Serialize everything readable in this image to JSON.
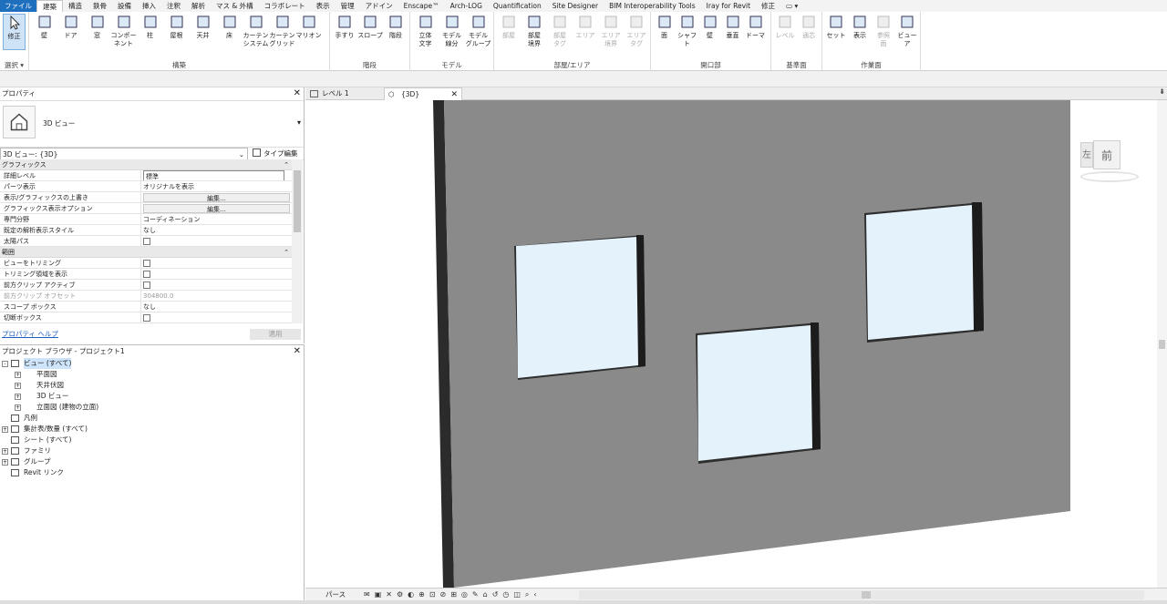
{
  "ribbon_tabs": [
    "ファイル",
    "建築",
    "構造",
    "鉄骨",
    "設備",
    "挿入",
    "注釈",
    "解析",
    "マス & 外構",
    "コラボレート",
    "表示",
    "管理",
    "アドイン",
    "Enscape™",
    "Arch-LOG",
    "Quantification",
    "Site Designer",
    "BIM Interoperability Tools",
    "Iray for Revit",
    "修正"
  ],
  "active_tab": "建築",
  "ribbon": {
    "select": {
      "modify": "修正",
      "label": "選択"
    },
    "build": {
      "items": [
        "壁",
        "ドア",
        "窓",
        "コンポーネント",
        "柱",
        "屋根",
        "天井",
        "床",
        "カーテン\nシステム",
        "カーテン\nグリッド",
        "マリオン"
      ],
      "label": "構築"
    },
    "circulation": {
      "items": [
        "手すり",
        "スロープ",
        "階段"
      ],
      "label": "階段"
    },
    "model": {
      "items": [
        "立体\n文字",
        "モデル\n線分",
        "モデル\nグループ"
      ],
      "label": "モデル"
    },
    "room": {
      "items": [
        "部屋",
        "部屋\n境界",
        "部屋\nタグ",
        "エリア",
        "エリア\n境界",
        "エリア\nタグ"
      ],
      "label": "部屋/エリア"
    },
    "opening": {
      "items": [
        "面",
        "シャフト",
        "壁",
        "垂直",
        "ドーマ"
      ],
      "label": "開口部"
    },
    "datum": {
      "items": [
        "レベル",
        "通芯"
      ],
      "label": "基準面"
    },
    "workplane": {
      "items": [
        "セット",
        "表示",
        "参照\n面",
        "ビューア"
      ],
      "label": "作業面"
    }
  },
  "properties": {
    "title": "プロパティ",
    "type_name": "3D ビュー",
    "instance": "3D ビュー: {3D}",
    "edit_type": "タイプ編集",
    "sections": [
      {
        "name": "グラフィックス",
        "rows": [
          {
            "k": "詳細レベル",
            "v": "標準",
            "kind": "input"
          },
          {
            "k": "パーツ表示",
            "v": "オリジナルを表示",
            "kind": "text"
          },
          {
            "k": "表示/グラフィックスの上書き",
            "v": "編集...",
            "kind": "button"
          },
          {
            "k": "グラフィックス表示オプション",
            "v": "編集...",
            "kind": "button"
          },
          {
            "k": "専門分野",
            "v": "コーディネーション",
            "kind": "text"
          },
          {
            "k": "既定の解析表示スタイル",
            "v": "なし",
            "kind": "text"
          },
          {
            "k": "太陽パス",
            "v": "",
            "kind": "check"
          }
        ]
      },
      {
        "name": "範囲",
        "rows": [
          {
            "k": "ビューをトリミング",
            "v": "",
            "kind": "check"
          },
          {
            "k": "トリミング領域を表示",
            "v": "",
            "kind": "check"
          },
          {
            "k": "前方クリップ アクティブ",
            "v": "",
            "kind": "check"
          },
          {
            "k": "前方クリップ オフセット",
            "v": "304800.0",
            "kind": "grey"
          },
          {
            "k": "スコープ ボックス",
            "v": "なし",
            "kind": "text"
          },
          {
            "k": "切断ボックス",
            "v": "",
            "kind": "check"
          }
        ]
      }
    ],
    "help": "プロパティ ヘルプ",
    "apply": "適用"
  },
  "browser": {
    "title": "プロジェクト ブラウザ - プロジェクト1",
    "items": [
      {
        "label": "ビュー (すべて)",
        "level": 0,
        "pm": "-",
        "icon": true,
        "hl": true
      },
      {
        "label": "平面図",
        "level": 1,
        "pm": "+",
        "icon": false,
        "hl": false
      },
      {
        "label": "天井伏図",
        "level": 1,
        "pm": "+",
        "icon": false,
        "hl": false
      },
      {
        "label": "3D ビュー",
        "level": 1,
        "pm": "+",
        "icon": false,
        "hl": false
      },
      {
        "label": "立面図 (建物の立面)",
        "level": 1,
        "pm": "+",
        "icon": false,
        "hl": false
      },
      {
        "label": "凡例",
        "level": 0,
        "pm": "",
        "icon": true,
        "hl": false
      },
      {
        "label": "集計表/数量 (すべて)",
        "level": 0,
        "pm": "+",
        "icon": true,
        "hl": false
      },
      {
        "label": "シート (すべて)",
        "level": 0,
        "pm": "",
        "icon": true,
        "hl": false
      },
      {
        "label": "ファミリ",
        "level": 0,
        "pm": "+",
        "icon": true,
        "hl": false
      },
      {
        "label": "グループ",
        "level": 0,
        "pm": "+",
        "icon": true,
        "hl": false
      },
      {
        "label": "Revit リンク",
        "level": 0,
        "pm": "",
        "icon": true,
        "hl": false
      }
    ]
  },
  "view_tabs": [
    {
      "label": "レベル 1",
      "active": false
    },
    {
      "label": "{3D}",
      "active": true
    }
  ],
  "viewcube": {
    "left": "左",
    "front": "前"
  },
  "view_control": {
    "scale": "パース"
  },
  "colors": {
    "wall": "#8a8a8a",
    "glass": "#e4f2fb",
    "file_tab": "#1f6fbf"
  }
}
